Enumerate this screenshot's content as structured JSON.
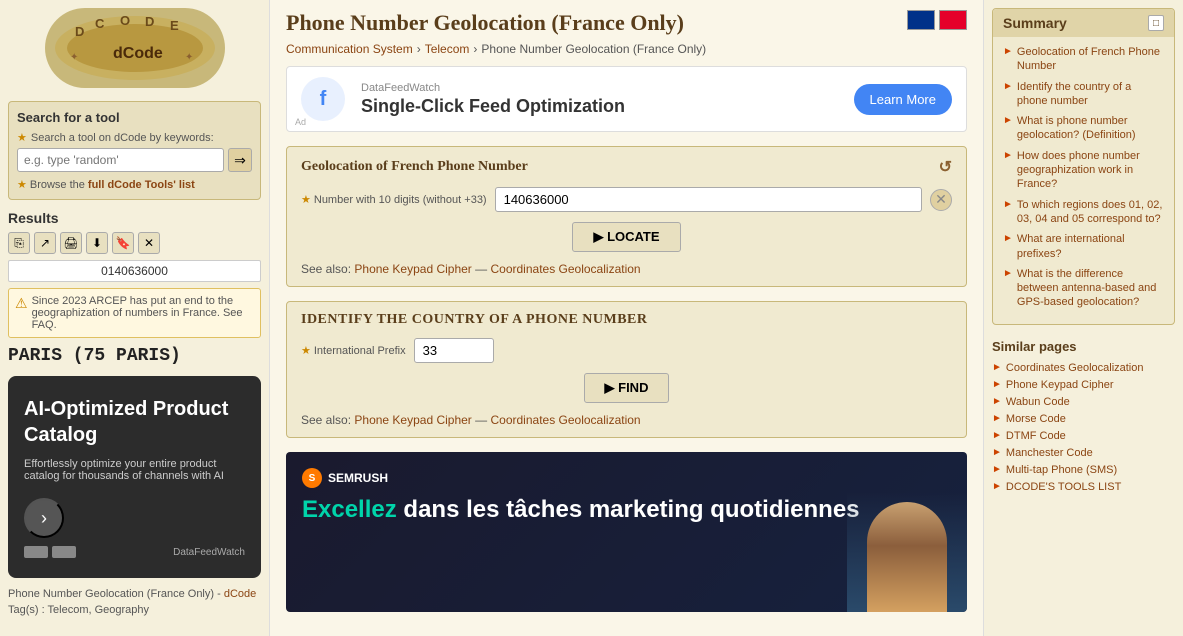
{
  "sidebar": {
    "search": {
      "title": "Search for a tool",
      "label": "Search a tool on dCode by keywords:",
      "placeholder": "e.g. type 'random'",
      "browse_label": "Browse the",
      "browse_link_text": "full dCode Tools' list"
    },
    "results": {
      "title": "Results",
      "number": "0140636000"
    },
    "warning": {
      "text": "Since 2023 ARCEP has put an end to the geographization of numbers in France. See FAQ."
    },
    "location": "PARIS (75 PARIS)",
    "ad": {
      "title": "AI-Optimized Product Catalog",
      "desc": "Effortlessly optimize your entire product catalog for thousands of channels with AI",
      "brand": "DataFeedWatch"
    },
    "bottom_link_text": "Phone Number Geolocation (France Only) -",
    "bottom_link": "dCode",
    "tags": "Tag(s) : Telecom, Geography"
  },
  "main": {
    "page_title": "Phone Number Geolocation (France Only)",
    "breadcrumb": [
      {
        "label": "Communication System",
        "href": "#"
      },
      {
        "label": "Telecom",
        "href": "#"
      },
      {
        "label": "Phone Number Geolocation (France Only)",
        "href": "#"
      }
    ],
    "banner_ad": {
      "brand": "DataFeedWatch",
      "headline": "Single-Click Feed Optimization",
      "cta": "Learn More",
      "ad_label": "Ad"
    },
    "geolocation_section": {
      "title": "Geolocation of French Phone Number",
      "input_label": "Number with 10 digits (without +33)",
      "input_value": "140636000",
      "locate_btn": "▶ LOCATE",
      "see_also_prefix": "See also:",
      "see_also_link1": "Phone Keypad Cipher",
      "see_also_sep": "—",
      "see_also_link2": "Coordinates Geolocalization"
    },
    "identify_section": {
      "title": "Identify the Country of a Phone Number",
      "input_label": "International Prefix",
      "input_value": "33",
      "find_btn": "▶ FIND",
      "see_also_prefix": "See also:",
      "see_also_link1": "Phone Keypad Cipher",
      "see_also_sep": "—",
      "see_also_link2": "Coordinates Geolocalization"
    },
    "ad2": {
      "brand": "SEMRUSH",
      "headline_part1": "Excellez",
      "headline_part2": " dans les tâches marketing quotidiennes"
    }
  },
  "right": {
    "summary": {
      "title": "Summary",
      "items": [
        {
          "text": "Geolocation of French Phone Number"
        },
        {
          "text": "Identify the country of a phone number"
        },
        {
          "text": "What is phone number geolocation? (Definition)"
        },
        {
          "text": "How does phone number geographization work in France?"
        },
        {
          "text": "To which regions does 01, 02, 03, 04 and 05 correspond to?"
        },
        {
          "text": "What are international prefixes?"
        },
        {
          "text": "What is the difference between antenna-based and GPS-based geolocation?"
        }
      ]
    },
    "similar": {
      "title": "Similar pages",
      "items": [
        {
          "text": "Coordinates Geolocalization"
        },
        {
          "text": "Phone Keypad Cipher"
        },
        {
          "text": "Wabun Code"
        },
        {
          "text": "Morse Code"
        },
        {
          "text": "DTMF Code"
        },
        {
          "text": "Manchester Code"
        },
        {
          "text": "Multi-tap Phone (SMS)"
        },
        {
          "text": "DCODE'S TOOLS LIST"
        }
      ]
    }
  },
  "icons": {
    "star": "★",
    "search_go": "⇒",
    "copy": "⎘",
    "share": "↗",
    "print": "🖨",
    "download": "⬇",
    "bookmark": "🔖",
    "close": "✕",
    "warning": "⚠",
    "refresh": "↺",
    "clear": "✕",
    "arrow_right": "►",
    "summary_toggle": "□",
    "summary_arrow": "►"
  }
}
